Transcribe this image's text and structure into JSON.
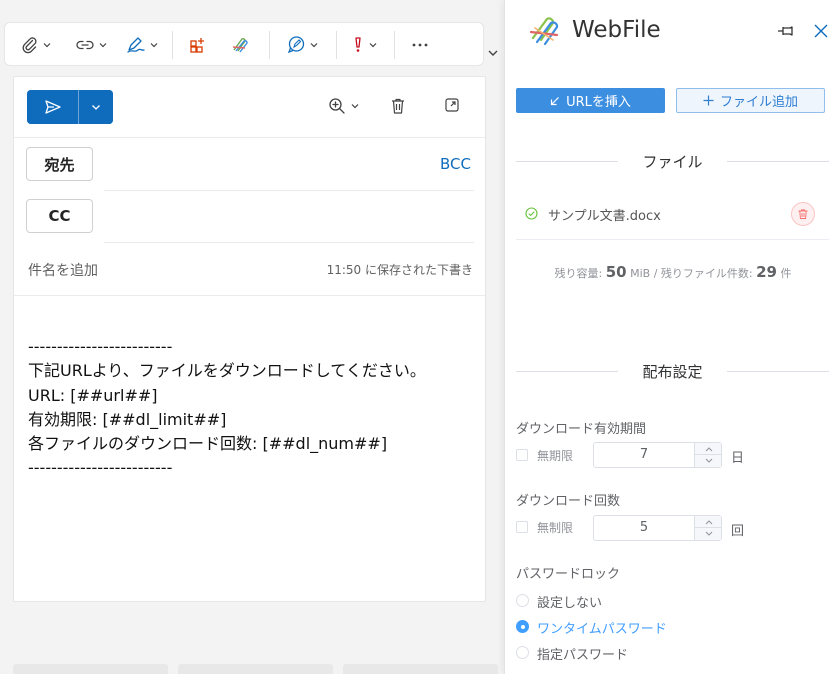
{
  "compose": {
    "to_label": "宛先",
    "cc_label": "CC",
    "bcc_label": "BCC",
    "subject_placeholder": "件名を追加",
    "saved_status": "11:50 に保存された下書き",
    "body_lines": [
      "-------------------------",
      "下記URLより、ファイルをダウンロードしてください。",
      "URL: [##url##]",
      "有効期限: [##dl_limit##]",
      "各ファイルのダウンロード回数: [##dl_num##]",
      "-------------------------"
    ]
  },
  "webfile": {
    "title": "WebFile",
    "insert_url_label": "URLを挿入",
    "add_file_label": "ファイル追加",
    "files_section": "ファイル",
    "files": [
      {
        "name": "サンプル文書.docx"
      }
    ],
    "remaining": {
      "capacity_label": "残り容量:",
      "capacity_value": "50",
      "capacity_unit": "MiB / 残りファイル件数:",
      "count_value": "29",
      "count_unit": "件"
    },
    "distribution_section": "配布設定",
    "download_period": {
      "label": "ダウンロード有効期間",
      "unlimited_label": "無期限",
      "unlimited_checked": false,
      "value": "7",
      "unit": "日"
    },
    "download_count": {
      "label": "ダウンロード回数",
      "unlimited_label": "無制限",
      "unlimited_checked": false,
      "value": "5",
      "unit": "回"
    },
    "password_lock": {
      "label": "パスワードロック",
      "options": [
        {
          "label": "設定しない",
          "selected": false
        },
        {
          "label": "ワンタイムパスワード",
          "selected": true
        },
        {
          "label": "指定パスワード",
          "selected": false
        }
      ]
    }
  },
  "colors": {
    "accent": "#0f6cbd",
    "pane_primary": "#3c8ee0",
    "radio_active": "#409eff",
    "danger": "#f56c6c",
    "success": "#67c23a"
  }
}
